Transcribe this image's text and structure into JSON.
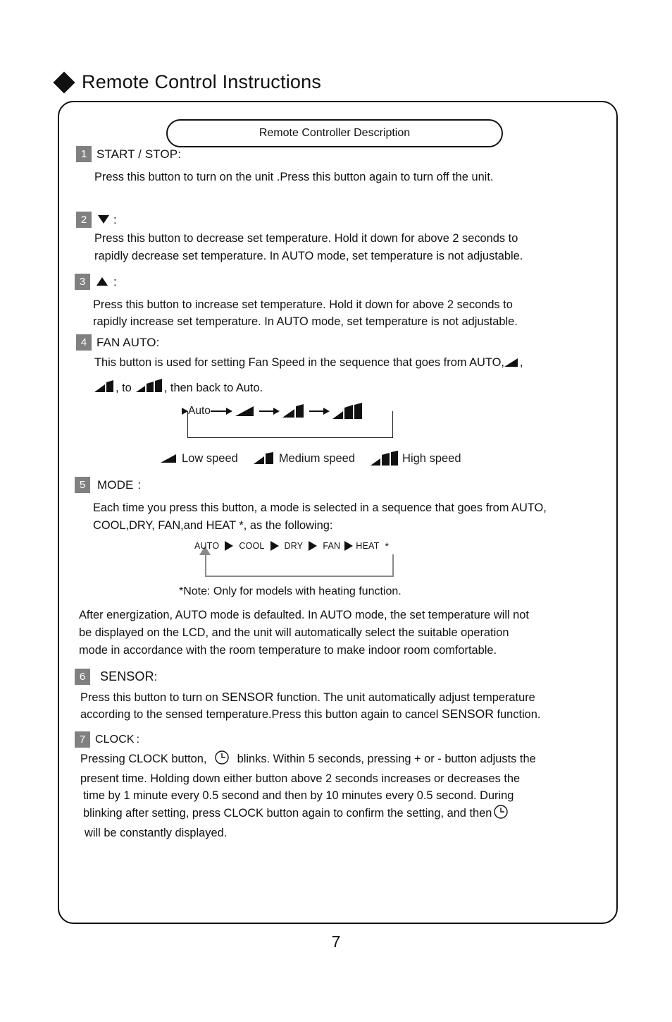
{
  "page": {
    "title": "Remote Control Instructions",
    "page_number": "7",
    "header_box_label": "Remote  Controller Description"
  },
  "sections": [
    {
      "number": "1",
      "label": "START / STOP",
      "colon": ":",
      "body": "Press this button to turn on the unit .Press this button again to turn off the unit."
    },
    {
      "number": "2",
      "label": "",
      "icon": "triangle-down-icon",
      "colon": ":",
      "body_line1": "Press this button to decrease set temperature. Hold it down for above 2 seconds to",
      "body_line2": "rapidly decrease set temperature. In AUTO mode, set temperature is not adjustable."
    },
    {
      "number": "3",
      "label": "",
      "icon": "triangle-up-icon",
      "colon": ":",
      "body_line1": "Press this button to increase set temperature. Hold it down for above 2 seconds to",
      "body_line2": "rapidly increase set temperature. In AUTO mode, set temperature is not adjustable."
    },
    {
      "number": "4",
      "label": "FAN AUTO",
      "colon": ":",
      "body_line1_a": "This button is used for setting Fan Speed in the sequence that goes from AUTO,",
      "body_line1_b": ",",
      "body_line2_a": ", to",
      "body_line2_b": ", then back to Auto."
    },
    {
      "number": "5",
      "label": "MODE",
      "colon": ":",
      "body_line1": "Each time you press this button, a mode is selected in a sequence that goes from AUTO,",
      "body_line2": "COOL,DRY, FAN,and HEAT  *, as the following:",
      "note": "*Note: Only for models with heating function.",
      "after_line1": "After energization, AUTO mode is  defaulted. In AUTO mode, the set temperature will not",
      "after_line2": "be displayed on the LCD, and the unit will automatically select the suitable operation",
      "after_line3": "mode in accordance with the room temperature to make indoor room comfortable."
    },
    {
      "number": "6",
      "label": "SENSOR",
      "colon": ":",
      "body_line1_a": "Press this button to turn on",
      "body_line1_strong": "SENSOR",
      "body_line1_b": "function. The unit automatically adjust temperature",
      "body_line2_a": "according to the sensed temperature.",
      "body_line2_b": "Press this button again to cancel",
      "body_line2_strong": "SENSOR",
      "body_line2_c": "function."
    },
    {
      "number": "7",
      "label": "CLOCK",
      "colon": ":",
      "body_line1_a": "Pressing CLOCK button,",
      "body_line1_b": "blinks. Within 5 seconds, pressing + or - button adjusts the",
      "body_line2": "present time. Holding down either button above 2 seconds increases or decreases the",
      "body_line3": "time by 1 minute every 0.5 second and then by 10 minutes every 0.5 second. During",
      "body_line4_a": "blinking after setting, press CLOCK button again to confirm the setting, and then",
      "body_line5": "will be constantly displayed."
    }
  ],
  "fan_sequence": {
    "auto_label": "Auto",
    "steps": [
      "Auto",
      "low-fan-icon",
      "medium-fan-icon",
      "high-fan-icon"
    ],
    "legend": [
      {
        "icon": "low-fan-icon",
        "label": "Low speed"
      },
      {
        "icon": "medium-fan-icon",
        "label": "Medium speed"
      },
      {
        "icon": "high-fan-icon",
        "label": "High speed"
      }
    ]
  },
  "mode_sequence": {
    "items": [
      "AUTO",
      "COOL",
      "DRY",
      "FAN",
      "HEAT"
    ],
    "asterisk": "*",
    "loop_color": "#8a8a8e"
  },
  "colors": {
    "badge_background": "#808080",
    "badge_text": "#ffffff",
    "ink": "#111111",
    "loop_gray": "#8a8a8e"
  }
}
